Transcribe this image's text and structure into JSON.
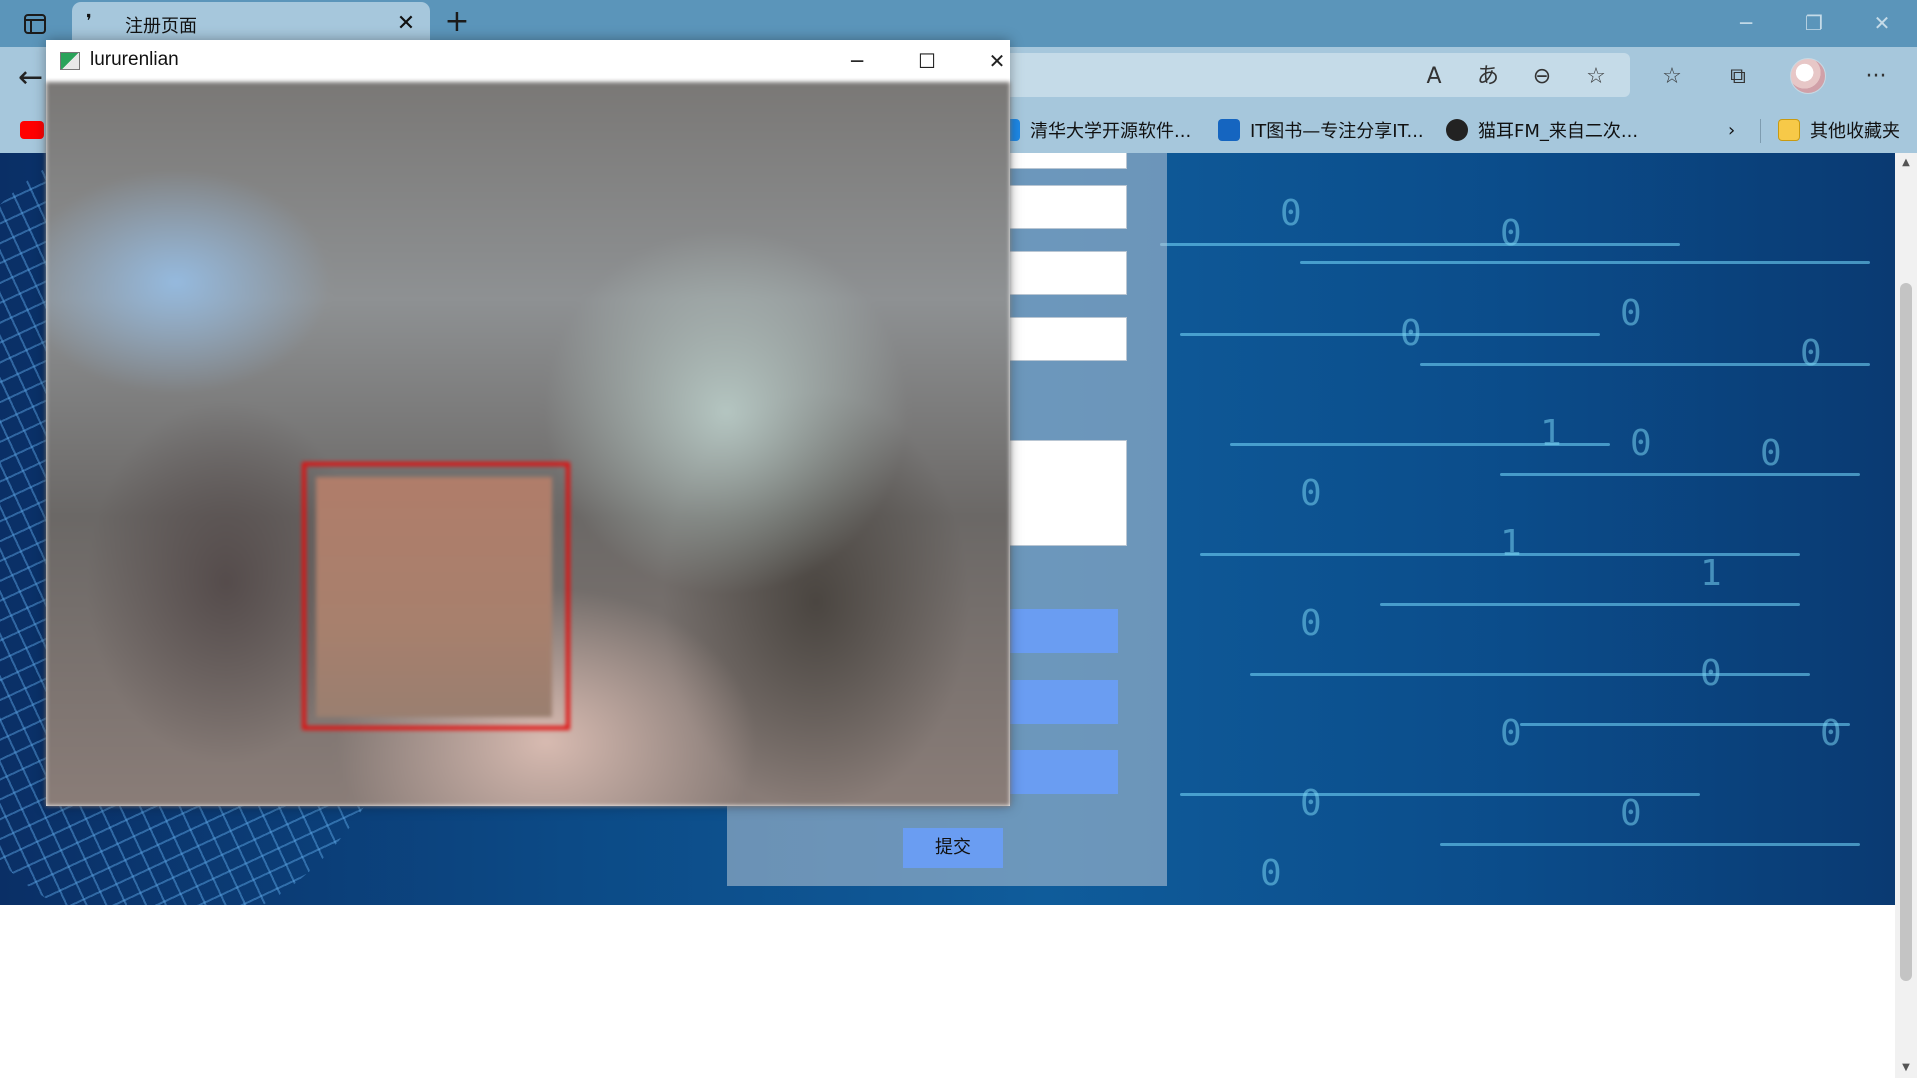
{
  "browser": {
    "tab": {
      "title": "注册页面"
    },
    "favorites": [
      {
        "label": "清华大学开源软件..."
      },
      {
        "label": "IT图书—专注分享IT..."
      },
      {
        "label": "猫耳FM_来自二次..."
      },
      {
        "label": "其他收藏夹"
      }
    ],
    "colors": {
      "tabbar": "#5b95ba",
      "toolbar": "#a6c7dc"
    }
  },
  "camera_window": {
    "title": "lururenlian"
  },
  "form": {
    "submit_label": "提交",
    "button_color": "#6a9df2"
  },
  "icons": [
    "tab-actions-icon",
    "close-icon",
    "plus-icon",
    "minimize-icon",
    "restore-icon",
    "back-arrow-icon",
    "read-aloud-icon",
    "translate-icon",
    "zoom-out-icon",
    "add-favorite-icon",
    "favorites-icon",
    "collections-icon",
    "more-icon",
    "chevron-right-icon",
    "folder-icon",
    "youtube-icon"
  ]
}
